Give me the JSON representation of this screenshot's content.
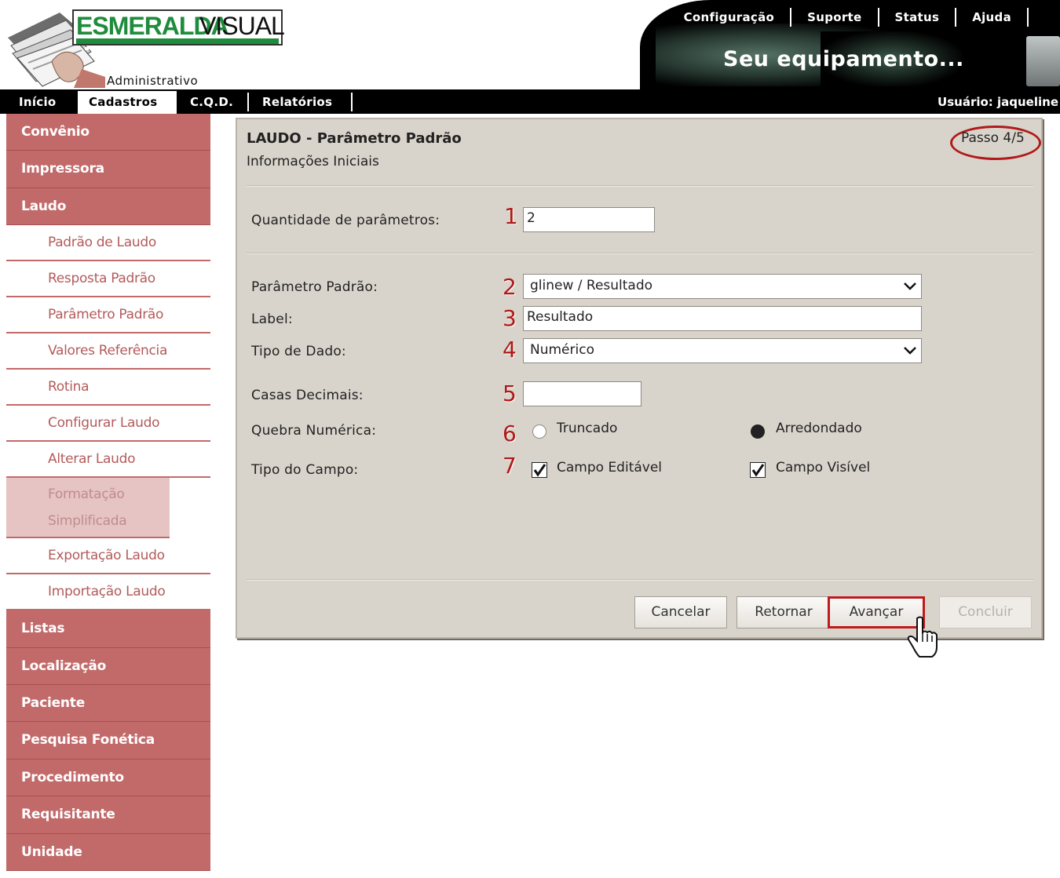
{
  "brand": {
    "name_primary": "ESMERALDA",
    "name_secondary": "VISUAL",
    "subtitle": "Administrativo"
  },
  "banner": {
    "slogan": "Seu equipamento...",
    "links": [
      "Configuração",
      "Suporte",
      "Status",
      "Ajuda"
    ]
  },
  "mainnav": {
    "items": [
      "Início",
      "Cadastros",
      "C.Q.D.",
      "Relatórios"
    ],
    "active": "Cadastros",
    "user": "Usuário: jaqueline"
  },
  "sidebar": {
    "top_items": [
      "Convênio",
      "Impressora",
      "Laudo"
    ],
    "sub_items": [
      "Padrão de Laudo",
      "Resposta Padrão",
      "Parâmetro Padrão",
      "Valores Referência",
      "Rotina",
      "Configurar Laudo",
      "Alterar Laudo",
      "Formatação Simplificada",
      "Exportação Laudo",
      "Importação Laudo"
    ],
    "active_sub": "Formatação Simplificada",
    "bottom_items": [
      "Listas",
      "Localização",
      "Paciente",
      "Pesquisa Fonética",
      "Procedimento",
      "Requisitante",
      "Unidade"
    ]
  },
  "dialog": {
    "title": "LAUDO - Parâmetro Padrão",
    "subtitle": "Informações Iniciais",
    "step": "Passo 4/5",
    "fields": {
      "quantidade": {
        "label": "Quantidade de parâmetros:",
        "value": "2",
        "marker": "1"
      },
      "parametro": {
        "label": "Parâmetro Padrão:",
        "value": "glinew / Resultado",
        "marker": "2"
      },
      "label_field": {
        "label": "Label:",
        "value": "Resultado",
        "marker": "3"
      },
      "tipo_dado": {
        "label": "Tipo de Dado:",
        "value": "Numérico",
        "marker": "4"
      },
      "casas": {
        "label": "Casas Decimais:",
        "value": "",
        "marker": "5"
      },
      "quebra": {
        "label": "Quebra Numérica:",
        "marker": "6",
        "options": [
          "Truncado",
          "Arredondado"
        ],
        "selected": "Arredondado"
      },
      "tipo_campo": {
        "label": "Tipo do Campo:",
        "marker": "7",
        "options": [
          "Campo Editável",
          "Campo Visível"
        ],
        "checked": [
          true,
          true
        ]
      }
    },
    "buttons": {
      "cancelar": "Cancelar",
      "retornar": "Retornar",
      "avancar": "Avançar",
      "concluir": "Concluir"
    }
  },
  "colors": {
    "sidebar_main": "#c26a6a",
    "sidebar_sub_text": "#b45a5a",
    "panel_bg": "#d9d4cb",
    "annotation_red": "#b01818",
    "logo_green": "#1e8c3c"
  }
}
